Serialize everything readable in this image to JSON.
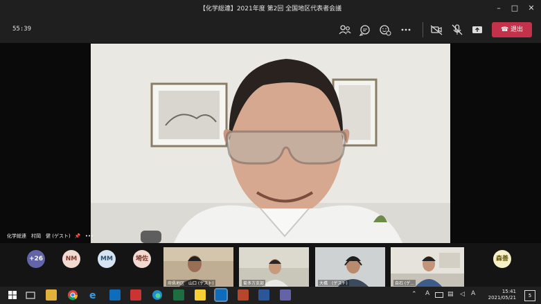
{
  "window": {
    "title": "【化学総連】2021年度 第2回 全国地区代表者会議"
  },
  "toolbar": {
    "timer": "55:39",
    "leave_label": "退出"
  },
  "main_video": {
    "name_tag": "化学総連　村岡　健 (ゲスト)"
  },
  "participants": {
    "overflow": "+26",
    "avatars": [
      {
        "initials": "NM",
        "bg": "#f4d9d0",
        "fg": "#7a3b2e"
      },
      {
        "initials": "MM",
        "bg": "#d5e4f2",
        "fg": "#2d4d6e"
      },
      {
        "initials": "埼佐",
        "bg": "#f4d9d0",
        "fg": "#7a3b2e"
      }
    ],
    "tiles": [
      {
        "label": "府県地区　山口 (ゲスト)"
      },
      {
        "label": "菊多方支部"
      },
      {
        "label": "大橋　(ゲスト)"
      },
      {
        "label": "自石 (ゲ..."
      }
    ],
    "right_avatar": {
      "initials": "森善",
      "bg": "#f6f0c8",
      "fg": "#6a5a10"
    }
  },
  "taskbar": {
    "time": "15:41",
    "date": "2021/05/21",
    "notif_badge": "5"
  },
  "colors": {
    "leave": "#c4314b",
    "titlebar": "#1f1f1f",
    "overflow_badge": "#6264a7"
  }
}
